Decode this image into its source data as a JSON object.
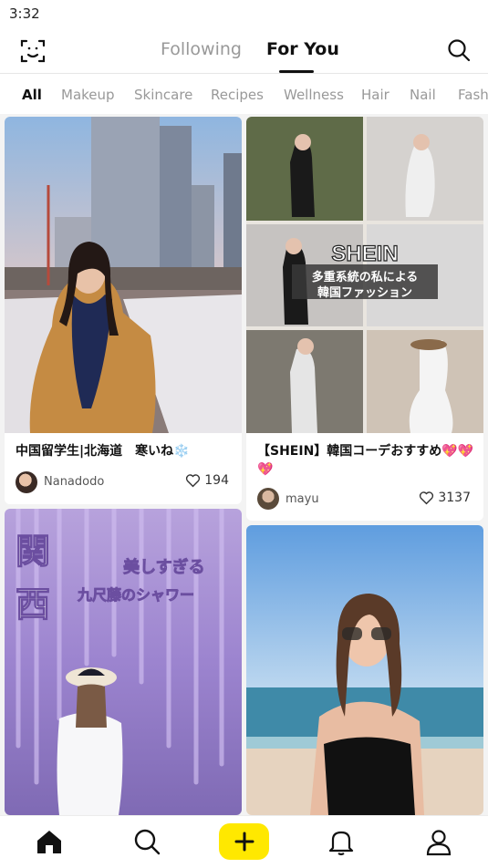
{
  "status_bar": {
    "time": "3:32"
  },
  "header": {
    "tabs": [
      {
        "label": "Following",
        "active": false
      },
      {
        "label": "For You",
        "active": true
      }
    ],
    "icons": [
      "face-scan-icon",
      "search-icon"
    ]
  },
  "categories": [
    "All",
    "Makeup",
    "Skincare",
    "Recipes",
    "Wellness",
    "Hair",
    "Nail",
    "Fash"
  ],
  "active_category": "All",
  "feed": [
    {
      "overlay_text": [],
      "title": "中国留学生|北海道　寒いね❄️",
      "author": "Nanadodo",
      "likes": "194"
    },
    {
      "overlay_text": [
        "SHEIN",
        "多重系統の私による",
        "韓国ファッション"
      ],
      "title": "【SHEIN】韓国コーデおすすめ💖💖💖",
      "author": "mayu",
      "likes": "3137"
    },
    {
      "overlay_text": [
        "関",
        "西",
        "美しすぎる",
        "九尺藤のシャワー"
      ],
      "title": "",
      "author": "",
      "likes": ""
    },
    {
      "overlay_text": [],
      "title": "",
      "author": "",
      "likes": ""
    }
  ],
  "bottom_nav": [
    "home-icon",
    "search-icon",
    "create-plus-icon",
    "notifications-bell-icon",
    "profile-icon"
  ],
  "colors": {
    "accent_yellow": "#ffe800",
    "text_primary": "#111111",
    "text_muted": "#999999"
  }
}
